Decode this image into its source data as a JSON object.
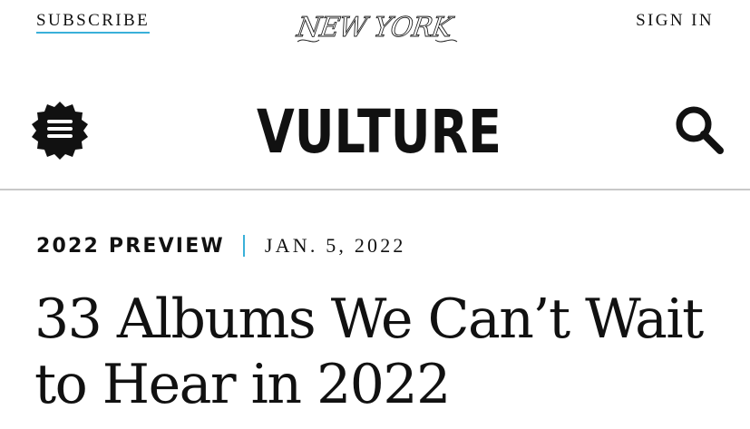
{
  "topbar": {
    "subscribe_label": "SUBSCRIBE",
    "brand_logo_text": "NEW YORK",
    "signin_label": "SIGN IN",
    "link_accent_color": "#3ab0d9"
  },
  "header": {
    "menu_icon": "hamburger-badge-icon",
    "site_logo_text": "VULTURE",
    "search_icon": "search-icon"
  },
  "article": {
    "rubric": "2022 PREVIEW",
    "date": "JAN. 5, 2022",
    "headline": "33 Albums We Can’t Wait to Hear in 2022"
  }
}
